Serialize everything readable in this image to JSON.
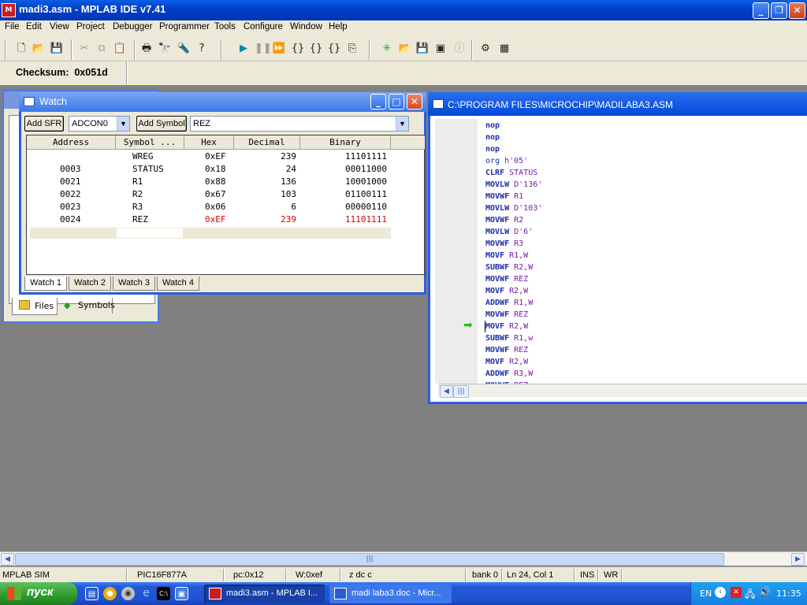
{
  "window": {
    "title": "madi3.asm - MPLAB IDE v7.41",
    "app_icon": "mplab-icon"
  },
  "menu": [
    "File",
    "Edit",
    "View",
    "Project",
    "Debugger",
    "Programmer",
    "Tools",
    "Configure",
    "Window",
    "Help"
  ],
  "checksum": {
    "label": "Checksum:",
    "value": "0x051d"
  },
  "project_window": {
    "tabs": [
      "Files",
      "Symbols"
    ]
  },
  "watch": {
    "title": "Watch",
    "add_sfr_label": "Add SFR",
    "sfr_selected": "ADCON0",
    "add_symbol_label": "Add Symbol",
    "symbol_selected": "REZ",
    "columns": [
      "Address",
      "Symbol ...",
      "Hex",
      "Decimal",
      "Binary"
    ],
    "rows": [
      {
        "address": "",
        "symbol": "WREG",
        "hex": "0xEF",
        "decimal": "239",
        "binary": "11101111"
      },
      {
        "address": "0003",
        "symbol": "STATUS",
        "hex": "0x18",
        "decimal": "24",
        "binary": "00011000"
      },
      {
        "address": "0021",
        "symbol": "R1",
        "hex": "0x88",
        "decimal": "136",
        "binary": "10001000"
      },
      {
        "address": "0022",
        "symbol": "R2",
        "hex": "0x67",
        "decimal": "103",
        "binary": "01100111"
      },
      {
        "address": "0023",
        "symbol": "R3",
        "hex": "0x06",
        "decimal": "6",
        "binary": "00000110"
      },
      {
        "address": "0024",
        "symbol": "REZ",
        "hex": "0xEF",
        "decimal": "239",
        "binary": "11101111",
        "highlight": true
      }
    ],
    "tabs": [
      "Watch 1",
      "Watch 2",
      "Watch 3",
      "Watch 4"
    ]
  },
  "editor": {
    "title": "C:\\PROGRAM FILES\\MICROCHIP\\MADILABA3.ASM",
    "lines": [
      {
        "op": "nop",
        "arg": ""
      },
      {
        "op": "nop",
        "arg": ""
      },
      {
        "op": "nop",
        "arg": ""
      },
      {
        "op": "org",
        "arg": "h'05'"
      },
      {
        "op": "CLRF",
        "arg": "STATUS"
      },
      {
        "op": "MOVLW",
        "arg": "D'136'"
      },
      {
        "op": "MOVWF",
        "arg": "R1"
      },
      {
        "op": "MOVLW",
        "arg": "D'103'"
      },
      {
        "op": "MOVWF",
        "arg": "R2"
      },
      {
        "op": "MOVLW",
        "arg": "D'6'"
      },
      {
        "op": "MOVWF",
        "arg": "R3"
      },
      {
        "op": "MOVF",
        "arg": "R1,W"
      },
      {
        "op": "SUBWF",
        "arg": "R2,W"
      },
      {
        "op": "MOVWF",
        "arg": "REZ"
      },
      {
        "op": "MOVF",
        "arg": "R2,W"
      },
      {
        "op": "ADDWF",
        "arg": "R1,W"
      },
      {
        "op": "MOVWF",
        "arg": "REZ"
      },
      {
        "op": "MOVF",
        "arg": "R2,W"
      },
      {
        "op": "SUBWF",
        "arg": "R1,w"
      },
      {
        "op": "MOVWF",
        "arg": "REZ"
      },
      {
        "op": "MOVF",
        "arg": "R2,W"
      },
      {
        "op": "ADDWF",
        "arg": "R3,W"
      },
      {
        "op": "MOVWF",
        "arg": "REZ"
      }
    ],
    "current_line_index": 17
  },
  "statusbar": {
    "debugger": "MPLAB SIM",
    "device": "PIC16F877A",
    "pc": "pc:0x12",
    "w": "W:0xef",
    "flags": "z dc c",
    "bank": "bank 0",
    "position": "Ln 24, Col 1",
    "ins": "INS",
    "wr": "WR"
  },
  "taskbar": {
    "start_label": "пуск",
    "tasks": [
      "madi3.asm - MPLAB I...",
      "madi laba3.doc - Micr..."
    ],
    "language": "EN",
    "clock": "11:35"
  },
  "colors": {
    "accent": "#0048d8",
    "highlight_red": "#e00000",
    "keyword_blue": "#1c2ca8",
    "operand_purple": "#7a1aa8"
  }
}
